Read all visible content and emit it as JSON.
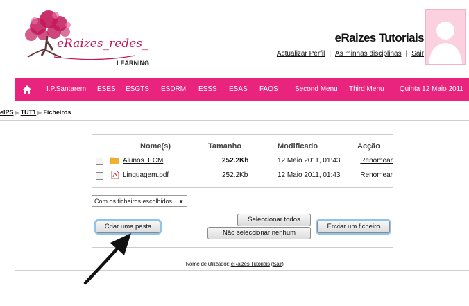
{
  "header": {
    "logo": {
      "text_main": "eRaizes_redes_",
      "text_sub": "LEARNING"
    },
    "site_title": "eRaizes Tutoriais",
    "links": [
      "Actualizar Perfil",
      "As minhas disciplinas",
      "Sair"
    ],
    "link_separator": "|"
  },
  "nav": {
    "items": [
      "I.P.Santarem",
      "ESES",
      "ESGTS",
      "ESDRM",
      "ESSS",
      "ESAS",
      "FAQS",
      "Second Menu",
      "Third Menu"
    ],
    "date": "Quinta 12 Maio 2011"
  },
  "breadcrumb": {
    "items": [
      "eIPS",
      "TUT1",
      "Ficheiros"
    ]
  },
  "table": {
    "headers": [
      "Nome(s)",
      "Tamanho",
      "Modificado",
      "Acção"
    ],
    "rows": [
      {
        "name": "Alunos_ECM",
        "type": "folder",
        "size": "252.2Kb",
        "modified": "12 Maio 2011, 01:43",
        "action": "Renomear"
      },
      {
        "name": "Linguagem.pdf",
        "type": "pdf",
        "size": "252.2Kb",
        "modified": "12 Maio 2011, 01:43",
        "action": "Renomear"
      }
    ]
  },
  "bulk_select": {
    "value": "Com os ficheiros escolhidos..."
  },
  "buttons": {
    "create_folder": "Criar uma pasta",
    "select_all": "Seleccionar todos",
    "select_none": "Não seleccionar nenhum",
    "upload": "Enviar um ficheiro"
  },
  "footer": {
    "prefix": "Nome de utilizador: ",
    "user": "eRaizes Tutoriais",
    "logout": "Sair"
  },
  "colors": {
    "nav": "#e8247e",
    "logo": "#c2185b",
    "highlight": "#8fc3ef"
  }
}
